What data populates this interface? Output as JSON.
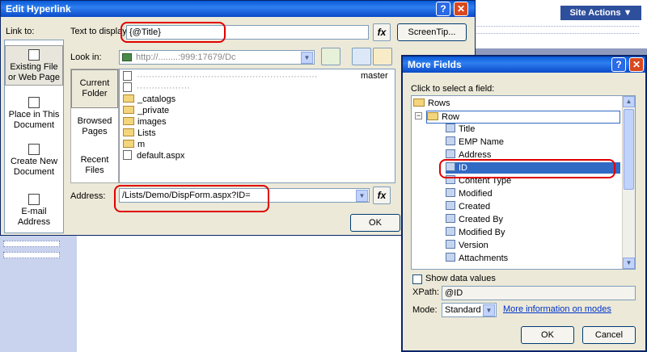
{
  "background": {
    "site_actions": "Site Actions ▼"
  },
  "edit_hyperlink": {
    "title": "Edit Hyperlink",
    "help_glyph": "?",
    "close_glyph": "✕",
    "link_to_label": "Link to:",
    "link_to_items": [
      {
        "label": "Existing File or Web Page"
      },
      {
        "label": "Place in This Document"
      },
      {
        "label": "Create New Document"
      },
      {
        "label": "E-mail Address"
      }
    ],
    "text_to_display_label": "Text to display:",
    "text_to_display_value": "{@Title}",
    "screentip_label": "ScreenTip...",
    "look_in_label": "Look in:",
    "look_in_value": "http://........:999:17679/Dc",
    "nav_items": [
      {
        "label": "Current Folder"
      },
      {
        "label": "Browsed Pages"
      },
      {
        "label": "Recent Files"
      }
    ],
    "files": [
      "_catalogs",
      "_private",
      "images",
      "Lists",
      "m",
      "default.aspx"
    ],
    "file_partial_right": "master",
    "address_label": "Address:",
    "address_value": "/Lists/Demo/DispForm.aspx?ID=",
    "fx_glyph": "fx",
    "ok_label": "OK"
  },
  "more_fields": {
    "title": "More Fields",
    "help_glyph": "?",
    "close_glyph": "✕",
    "click_label": "Click to select a field:",
    "tree_root": "Rows",
    "tree_row": "Row",
    "tree_minus": "−",
    "fields": [
      "Title",
      "EMP Name",
      "Address",
      "ID",
      "Content Type",
      "Modified",
      "Created",
      "Created By",
      "Modified By",
      "Version",
      "Attachments"
    ],
    "selected_field": "ID",
    "show_data_values_label": "Show data values",
    "xpath_label": "XPath:",
    "xpath_value": "@ID",
    "mode_label": "Mode:",
    "mode_value": "Standard",
    "more_info_link": "More information on modes",
    "ok_label": "OK",
    "cancel_label": "Cancel"
  }
}
